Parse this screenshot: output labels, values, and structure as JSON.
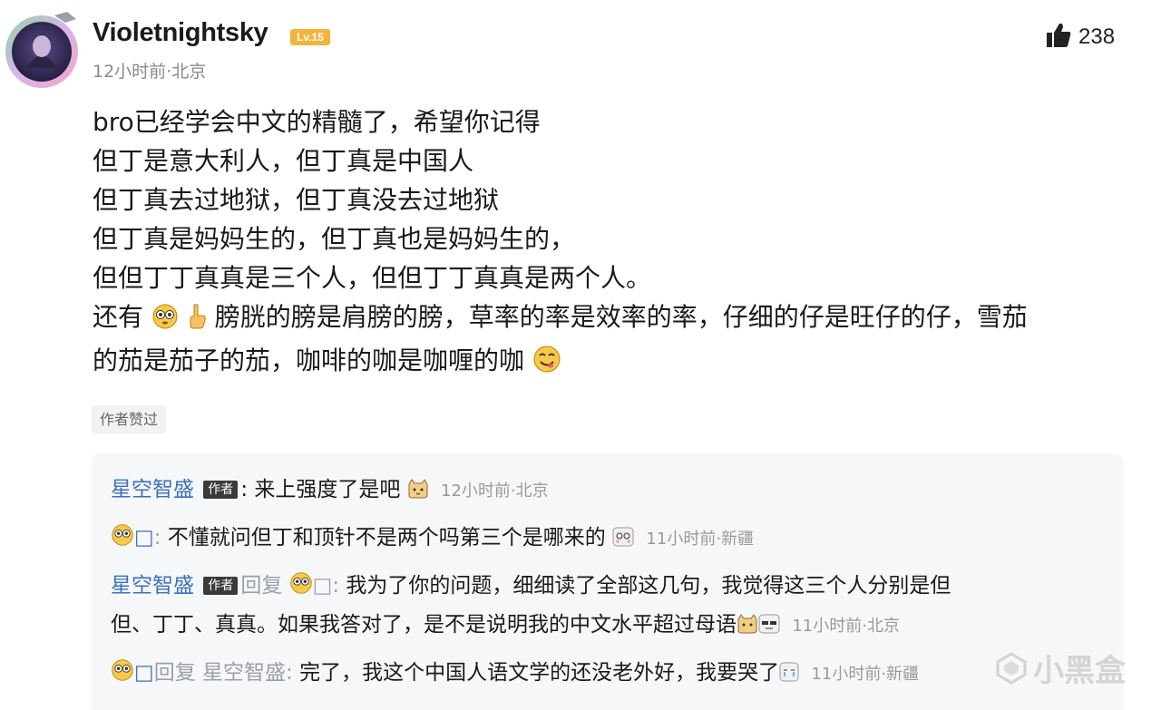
{
  "comment": {
    "username": "Violetnightsky",
    "level": "Lv.15",
    "meta": "12小时前·北京",
    "likes": "238",
    "lines": [
      "bro已经学会中文的精髓了，希望你记得",
      "但丁是意大利人，但丁真是中国人",
      "但丁真去过地狱，但丁真没去过地狱",
      "但丁真是妈妈生的，但丁真也是妈妈生的，",
      "但但丁丁真真是三个人，但但丁丁真真是两个人。"
    ],
    "line6_prefix": "还有",
    "line6_rest": "膀胱的膀是肩膀的膀，草率的率是效率的率，仔细的仔是旺仔的仔，雪茄",
    "line7": "的茄是茄子的茄，咖啡的咖是咖喱的咖",
    "author_liked": "作者赞过"
  },
  "replies": [
    {
      "name": "星空智盛",
      "tag": "作者",
      "sep": ": ",
      "text": "来上强度了是吧",
      "time": "12小时前·北京"
    },
    {
      "name": "□",
      "sep": ": ",
      "text": "不懂就问但丁和顶针不是两个吗第三个是哪来的",
      "time": "11小时前·新疆"
    },
    {
      "name": "星空智盛",
      "tag": "作者",
      "reply_word": "回复",
      "target": "□",
      "sep": ": ",
      "text": "我为了你的问题，细细读了全部这几句，我觉得这三个人分别是但",
      "text2": "但、丁丁、真真。如果我答对了，是不是说明我的中文水平超过母语",
      "time": "11小时前·北京"
    },
    {
      "name": "□",
      "reply_word": "回复",
      "target": "星空智盛",
      "sep": ": ",
      "text": "完了，我这个中国人语文学的还没老外好，我要哭了",
      "time": "11小时前·新疆"
    }
  ],
  "watermark": "小黑盒",
  "colors": {
    "username_link": "#3b72b8",
    "level_badge": "#f3b43c",
    "reply_bg": "#f6f7f9"
  }
}
